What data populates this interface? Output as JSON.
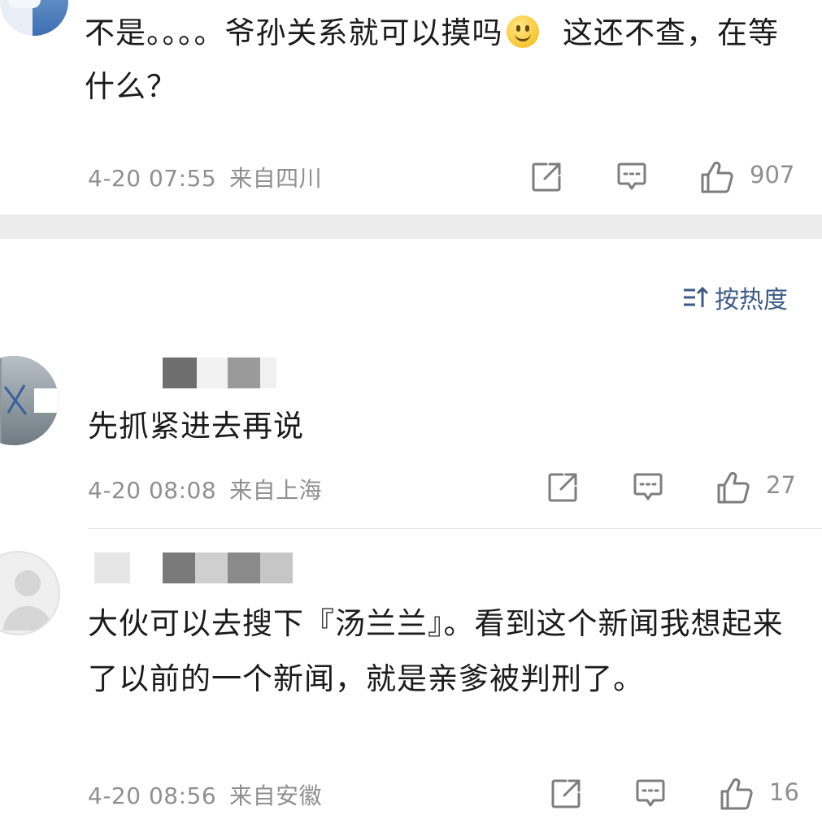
{
  "comments": [
    {
      "text_part1": "不是。。。。爷孙关系就可以摸吗",
      "emoji": "smiley-emoji",
      "text_part2": "  这还不查，在等什么？",
      "date": "4-20 07:55",
      "location": "来自四川",
      "likes": "907"
    },
    {
      "text": "先抓紧进去再说",
      "date": "4-20 08:08",
      "location": "来自上海",
      "likes": "27"
    },
    {
      "text": "大伙可以去搜下『汤兰兰』。看到这个新闻我想起来了以前的一个新闻，就是亲爹被判刑了。",
      "date": "4-20 08:56",
      "location": "来自安徽",
      "likes": "16"
    }
  ],
  "sort": {
    "label": "按热度",
    "icon": "sort-icon"
  },
  "icons": {
    "share": "share-icon",
    "comment": "comment-icon",
    "like": "like-icon"
  },
  "colors": {
    "meta_text": "#8f8f8f",
    "sort_text": "#3d5a86",
    "band": "#ececec"
  }
}
